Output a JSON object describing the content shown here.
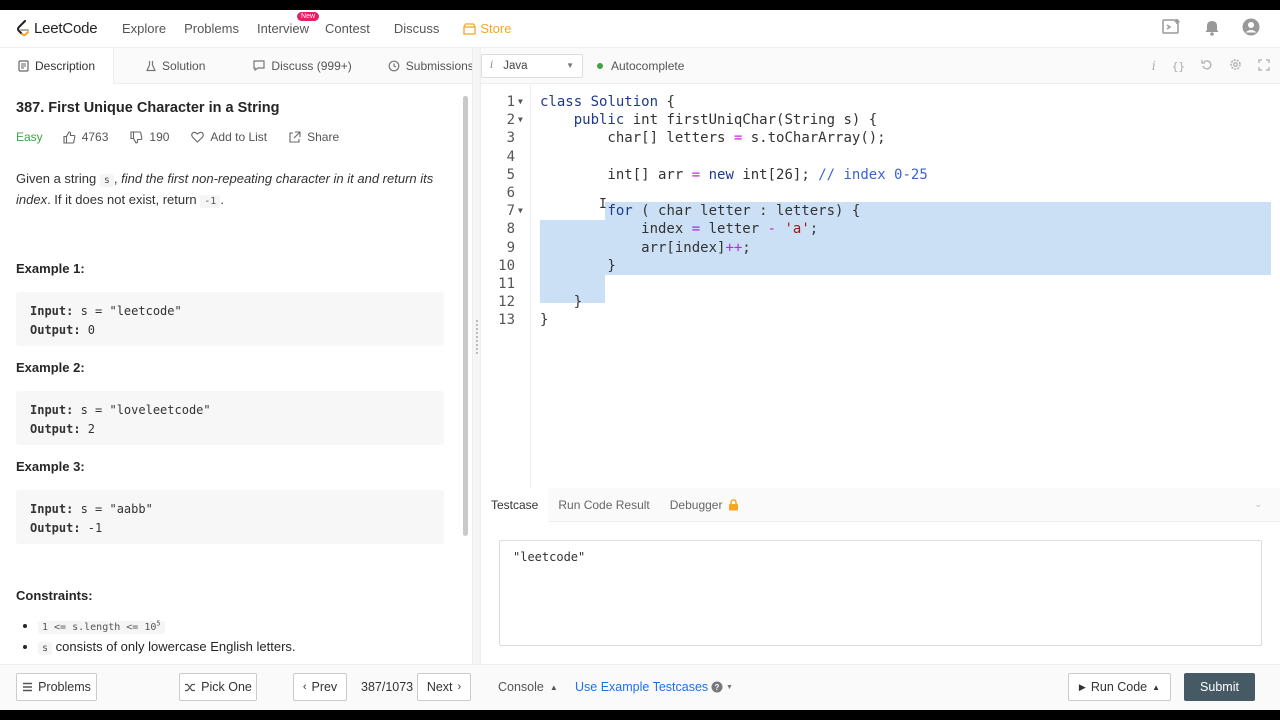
{
  "nav": {
    "logo": "LeetCode",
    "links": [
      "Explore",
      "Problems",
      "Interview",
      "Contest",
      "Discuss"
    ],
    "new_badge": "New",
    "store": "Store"
  },
  "left_tabs": {
    "description": "Description",
    "solution": "Solution",
    "discuss": "Discuss (999+)",
    "submissions": "Submissions"
  },
  "problem": {
    "title": "387. First Unique Character in a String",
    "difficulty": "Easy",
    "likes": "4763",
    "dislikes": "190",
    "add_to_list": "Add to List",
    "share": "Share",
    "desc_1": "Given a string ",
    "desc_s": "s",
    "desc_2": ", ",
    "desc_italic": "find the first non-repeating character in it and return its index",
    "desc_3": ". If it does not exist, return ",
    "desc_neg": "-1",
    "desc_4": ".",
    "examples": [
      {
        "heading": "Example 1:",
        "input_label": "Input:",
        "input": " s = \"leetcode\"",
        "output_label": "Output:",
        "output": " 0"
      },
      {
        "heading": "Example 2:",
        "input_label": "Input:",
        "input": " s = \"loveleetcode\"",
        "output_label": "Output:",
        "output": " 2"
      },
      {
        "heading": "Example 3:",
        "input_label": "Input:",
        "input": " s = \"aabb\"",
        "output_label": "Output:",
        "output": " -1"
      }
    ],
    "constraints_heading": "Constraints:",
    "constraint_1": "1 <= s.length <= 10",
    "constraint_1_sup": "5",
    "constraint_2_code": "s",
    "constraint_2": " consists of only lowercase English letters."
  },
  "editor": {
    "language": "Java",
    "autocomplete": "Autocomplete",
    "line_numbers": [
      "1",
      "2",
      "3",
      "4",
      "5",
      "6",
      "7",
      "8",
      "9",
      "10",
      "11",
      "12",
      "13"
    ]
  },
  "testcase": {
    "tabs": [
      "Testcase",
      "Run Code Result",
      "Debugger"
    ],
    "value": "\"leetcode\""
  },
  "bottom": {
    "problems": "Problems",
    "pick_one": "Pick One",
    "prev": "Prev",
    "page": "387/1073",
    "next": "Next",
    "console": "Console",
    "use_example": "Use Example Testcases",
    "run_code": "Run Code",
    "submit": "Submit"
  },
  "colors": {
    "easy": "#43a047",
    "store": "#f5a623",
    "link": "#1a73e8",
    "submit_bg": "#455a64",
    "selection": "#cce0f5"
  }
}
